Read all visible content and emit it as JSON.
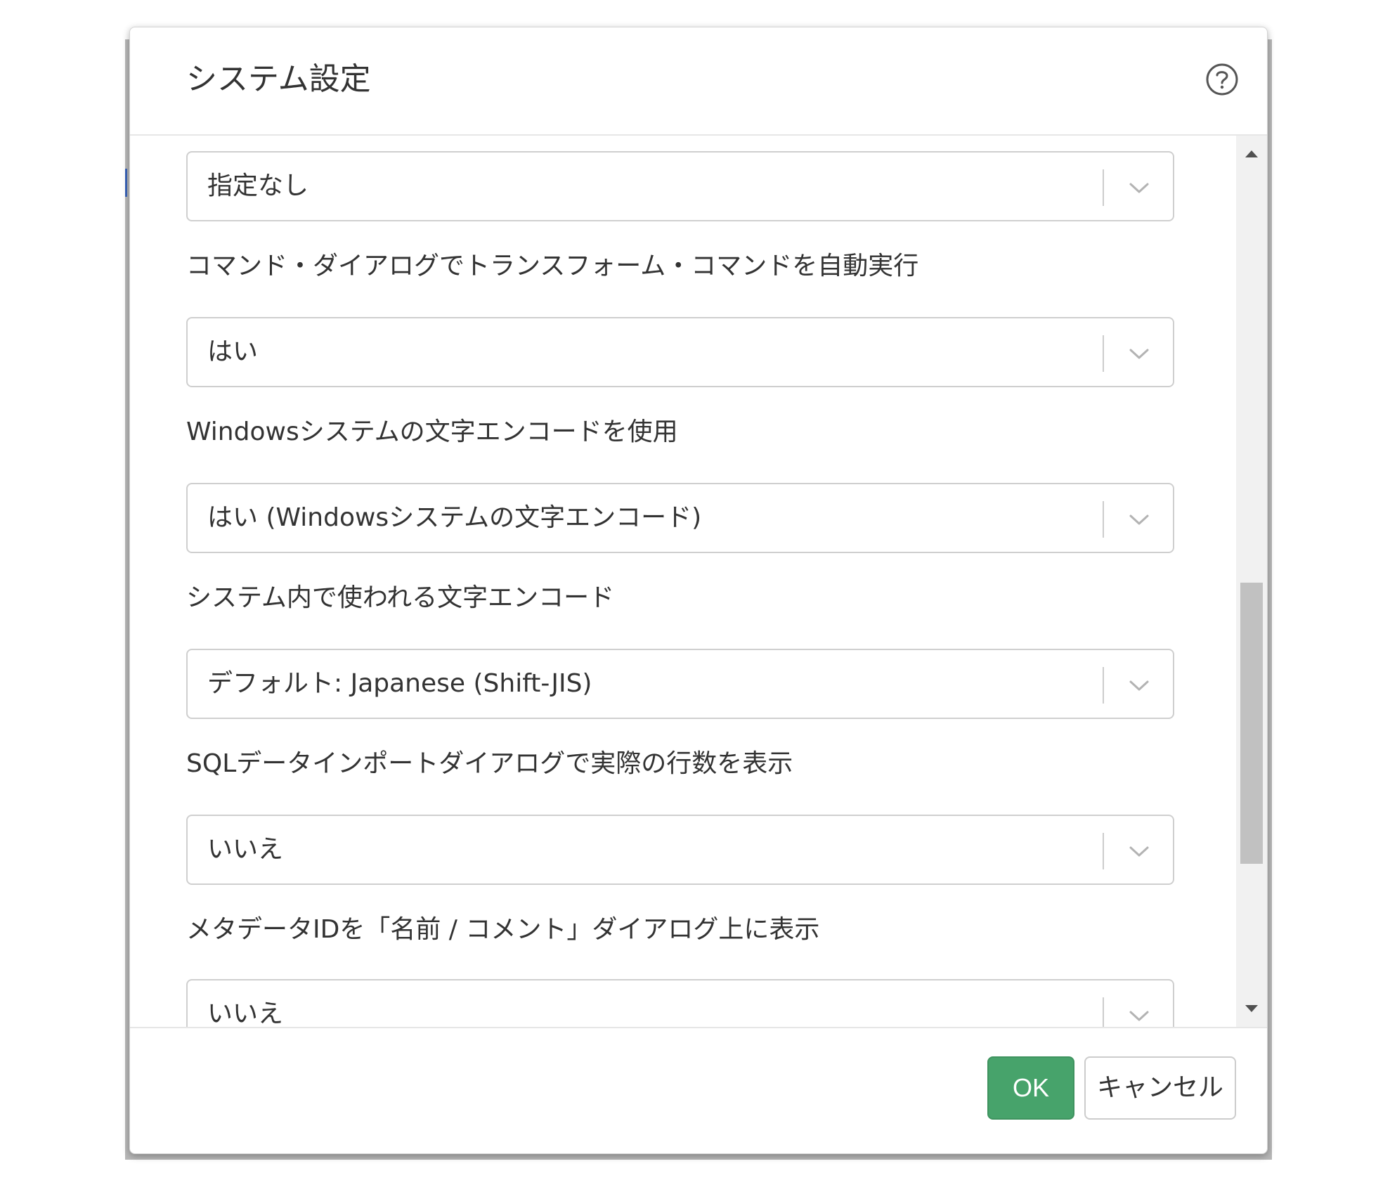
{
  "dialog": {
    "title": "システム設定",
    "help_icon": "question-circle-icon"
  },
  "settings": [
    {
      "label": "",
      "value": "指定なし"
    },
    {
      "label": "コマンド・ダイアログでトランスフォーム・コマンドを自動実行",
      "value": "はい"
    },
    {
      "label": "Windowsシステムの文字エンコードを使用",
      "value": "はい (Windowsシステムの文字エンコード)"
    },
    {
      "label": "システム内で使われる文字エンコード",
      "value": "デフォルト: Japanese (Shift-JIS)"
    },
    {
      "label": "SQLデータインポートダイアログで実際の行数を表示",
      "value": "いいえ"
    },
    {
      "label": "メタデータIDを「名前 / コメント」ダイアログ上に表示",
      "value": "いいえ"
    }
  ],
  "scrollbar": {
    "up_icon": "triangle-up-icon",
    "down_icon": "triangle-down-icon"
  },
  "footer": {
    "ok_label": "OK",
    "cancel_label": "キャンセル"
  },
  "colors": {
    "ok_button": "#47a36b",
    "text": "#333333",
    "border": "#cfcfcf"
  }
}
